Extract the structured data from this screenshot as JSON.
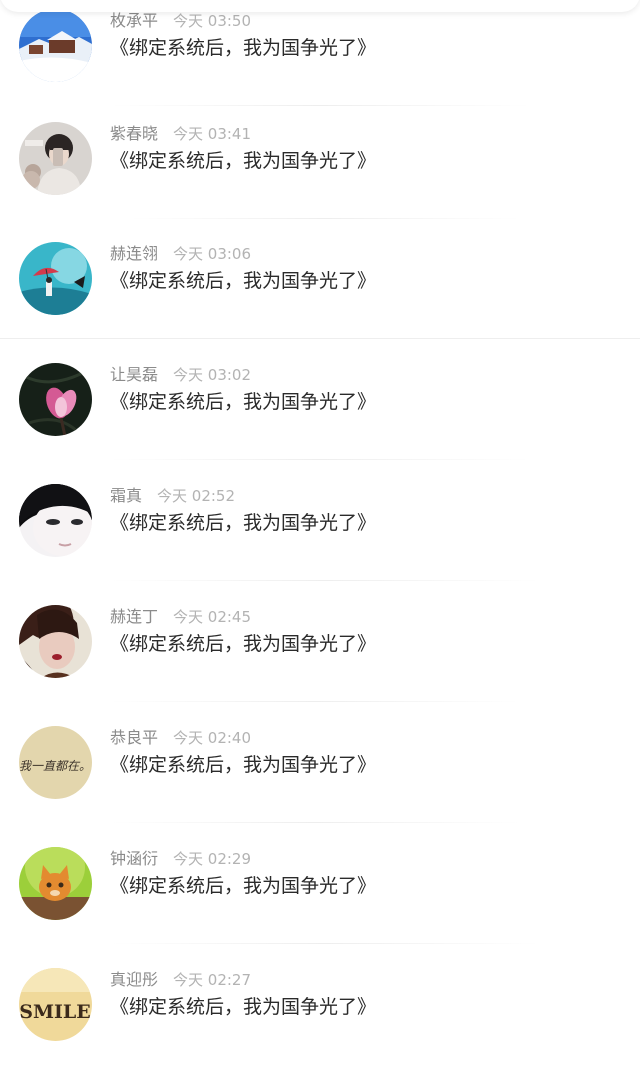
{
  "comments": [
    {
      "name": "枚承平",
      "time": "今天 03:50",
      "title": "《绑定系统后，我为国争光了》",
      "avatar_icon": "snowy-village-icon"
    },
    {
      "name": "紫春晓",
      "time": "今天 03:41",
      "title": "《绑定系统后，我为国争光了》",
      "avatar_icon": "girl-with-phone-icon"
    },
    {
      "name": "赫连翎",
      "time": "今天 03:06",
      "title": "《绑定系统后，我为国争光了》",
      "avatar_icon": "girl-with-umbrella-icon"
    },
    {
      "name": "让昊磊",
      "time": "今天 03:02",
      "title": "《绑定系统后，我为国争光了》",
      "avatar_icon": "magnolia-flower-icon"
    },
    {
      "name": "霜真",
      "time": "今天 02:52",
      "title": "《绑定系统后，我为国争光了》",
      "avatar_icon": "face-closeup-icon"
    },
    {
      "name": "赫连丁",
      "time": "今天 02:45",
      "title": "《绑定系统后，我为国争光了》",
      "avatar_icon": "woman-portrait-icon"
    },
    {
      "name": "恭良平",
      "time": "今天 02:40",
      "title": "《绑定系统后，我为国争光了》",
      "avatar_icon": "handwriting-text-icon"
    },
    {
      "name": "钟涵衍",
      "time": "今天 02:29",
      "title": "《绑定系统后，我为国争光了》",
      "avatar_icon": "kitten-icon"
    },
    {
      "name": "真迎彤",
      "time": "今天 02:27",
      "title": "《绑定系统后，我为国争光了》",
      "avatar_icon": "smile-cup-icon"
    }
  ],
  "avatar_texts": {
    "handwriting": "我一直都在。",
    "smile": "SMILE"
  }
}
